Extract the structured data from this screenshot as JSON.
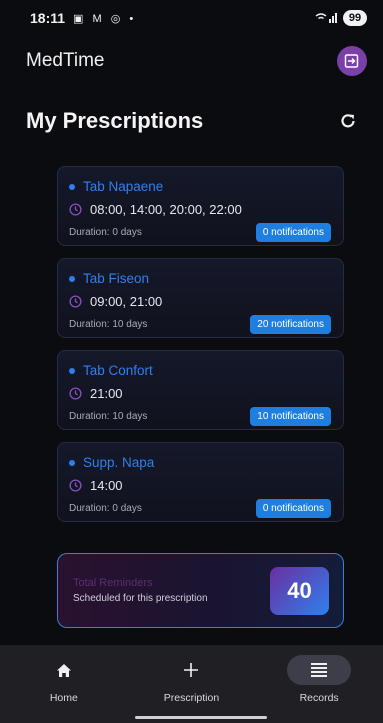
{
  "status_bar": {
    "time": "18:11",
    "icons": "▣ M ◎ •",
    "signal": "📶",
    "battery": "99"
  },
  "app": {
    "title": "MedTime"
  },
  "page": {
    "title": "My Prescriptions"
  },
  "prescriptions": [
    {
      "name": "Tab Napaene",
      "times": "08:00, 14:00, 20:00, 22:00",
      "duration": "Duration: 0 days",
      "notifications": "0 notifications"
    },
    {
      "name": "Tab Fiseon",
      "times": "09:00, 21:00",
      "duration": "Duration: 10 days",
      "notifications": "20 notifications"
    },
    {
      "name": "Tab Confort",
      "times": "21:00",
      "duration": "Duration: 10 days",
      "notifications": "10 notifications"
    },
    {
      "name": "Supp. Napa",
      "times": "14:00",
      "duration": "Duration: 0 days",
      "notifications": "0 notifications"
    }
  ],
  "summary": {
    "title": "Total Reminders",
    "subtitle": "Scheduled for this prescription",
    "total": "40"
  },
  "nav": {
    "items": [
      {
        "label": "Home",
        "icon": "home-icon"
      },
      {
        "label": "Prescription",
        "icon": "plus-icon"
      },
      {
        "label": "Records",
        "icon": "list-icon"
      }
    ],
    "active": "Records"
  },
  "colors": {
    "accent": "#2f80ed",
    "purple": "#7b3fa8",
    "background": "#0b0c10"
  }
}
